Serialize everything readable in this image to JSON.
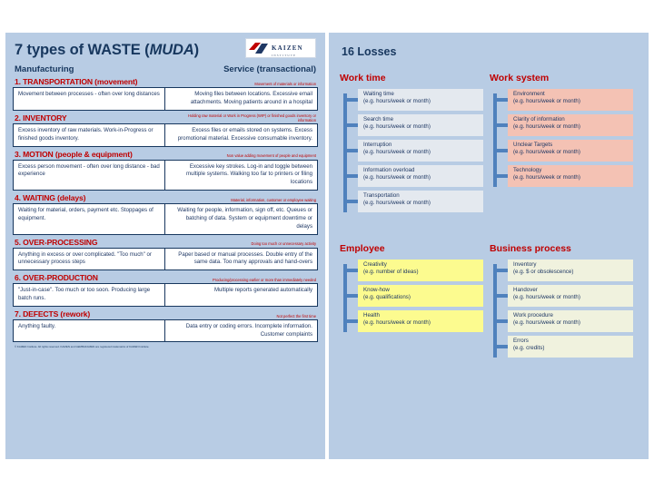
{
  "left_slide": {
    "logo": {
      "brand": "KAIZEN",
      "sub": "INSTITUTE"
    },
    "title_main": "7 types of WASTE (",
    "title_em": "MUDA",
    "title_close": ")",
    "column_headers": {
      "manufacturing": "Manufacturing",
      "service": "Service (transactional)"
    },
    "footer": "© KAIZEN Institute. All rights reserved. KAIZEN and GEMBAKAIZEN are registered trademarks of KAIZEN Institute.",
    "wastes": [
      {
        "num": "1. TRANSPORTATION (movement)",
        "desc": "Movement of materials or information",
        "manufacturing": "Movement between processes - often over long distances",
        "service": "Moving files between locations. Excessive email attachments. Moving patients around in a hospital"
      },
      {
        "num": "2. INVENTORY",
        "desc": "Holding raw material or Work in Progress (WIP) or finished goods inventory or information",
        "manufacturing": "Excess inventory of raw materials. Work-in-Progress or finished goods inventory.",
        "service": "Excess files or emails stored on systems. Excess promotional material. Excessive consumable inventory."
      },
      {
        "num": "3. MOTION (people & equipment)",
        "desc": "Non value adding movement of people and equipment",
        "manufacturing": "Excess person movement - often over long distance - bad experience",
        "service": "Excessive key strokes. Log-in and toggle between multiple systems. Walking too far to printers or filing locations"
      },
      {
        "num": "4. WAITING (delays)",
        "desc": "Material, information, customer or employee waiting",
        "manufacturing": "Waiting for material, orders, payment etc. Stoppages of equipment.",
        "service": "Waiting for people, information, sign off, etc. Queues or batching of data. System or equipment downtime or delays"
      },
      {
        "num": "5. OVER-PROCESSING",
        "desc": "Doing too much or unnecessary activity",
        "manufacturing": "Anything in excess or over complicated. \"Too much\" or unnecessary process steps",
        "service": "Paper based or manual processes. Double entry of the same data. Too many approvals and hand-overs"
      },
      {
        "num": "6. OVER-PRODUCTION",
        "desc": "Producing/processing earlier or more than immediately needed",
        "manufacturing": "\"Just-in-case\". Too much or too soon. Producing large batch runs.",
        "service": "Multiple reports generated automatically"
      },
      {
        "num": "7. DEFECTS (rework)",
        "desc": "Not perfect the first time",
        "manufacturing": "Anything faulty.",
        "service": "Data entry or coding errors. Incomplete information. Customer complaints"
      }
    ]
  },
  "right_slide": {
    "title": "16 Losses",
    "colors": {
      "work_time": "#e4e9ef",
      "work_system": "#f4c2b4",
      "employee": "#fcfb8f",
      "business_process": "#f0f2de",
      "spine": "#4f81bd",
      "heading": "#c00000",
      "background": "#b8cce4"
    },
    "groups": [
      {
        "name": "Work time",
        "style": "n-blue",
        "items": [
          {
            "title": "Waiting time",
            "sub": "(e.g. hours/week or month)"
          },
          {
            "title": "Search time",
            "sub": "(e.g. hours/week or month)"
          },
          {
            "title": "Interruption",
            "sub": "(e.g. hours/week or month)"
          },
          {
            "title": "Information overload",
            "sub": "(e.g. hours/week or month)"
          },
          {
            "title": "Transportation",
            "sub": "(e.g. hours/week or month)"
          }
        ]
      },
      {
        "name": "Work system",
        "style": "n-pink",
        "items": [
          {
            "title": "Environment",
            "sub": "(e.g. hours/week or month)"
          },
          {
            "title": "Clarity of information",
            "sub": "(e.g. hours/week or month)"
          },
          {
            "title": "Unclear Targets",
            "sub": "(e.g. hours/week or month)"
          },
          {
            "title": "Technology",
            "sub": "(e.g. hours/week or month)"
          }
        ]
      },
      {
        "name": "Employee",
        "style": "n-yellow",
        "items": [
          {
            "title": "Creativity",
            "sub": "(e.g. number of ideas)"
          },
          {
            "title": "Know-how",
            "sub": "(e.g. qualifications)"
          },
          {
            "title": "Health",
            "sub": "(e.g. hours/week or month)"
          }
        ]
      },
      {
        "name": "Business process",
        "style": "n-cream",
        "items": [
          {
            "title": "Inventory",
            "sub": "(e.g. $ or obsolescence)"
          },
          {
            "title": "Handover",
            "sub": "(e.g. hours/week or month)"
          },
          {
            "title": "Work procedure",
            "sub": "(e.g. hours/week or month)"
          },
          {
            "title": "Errors",
            "sub": "(e.g. credits)"
          }
        ]
      }
    ]
  }
}
